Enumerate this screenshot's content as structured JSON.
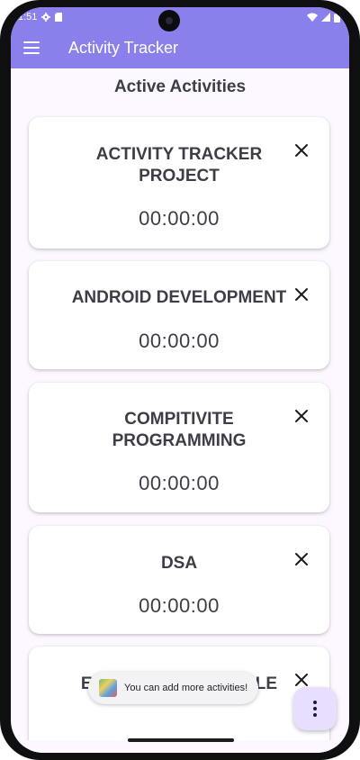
{
  "status_bar": {
    "time": "1:51",
    "icons": [
      "settings-icon",
      "sd-card-icon",
      "wifi-icon",
      "signal-icon",
      "battery-icon"
    ]
  },
  "app_bar": {
    "title": "Activity Tracker",
    "menu_icon": "hamburger-menu-icon"
  },
  "page": {
    "title": "Active Activities"
  },
  "activities": [
    {
      "name": "ACTIVITY TRACKER PROJECT",
      "time": "00:00:00"
    },
    {
      "name": "ANDROID DEVELOPMENT",
      "time": "00:00:00"
    },
    {
      "name": "COMPITIVITE PROGRAMMING",
      "time": "00:00:00"
    },
    {
      "name": "DSA",
      "time": "00:00:00"
    },
    {
      "name": "ENJOY THE STRUGGLE",
      "time": ""
    }
  ],
  "toast": {
    "message": "You can add more activities!"
  },
  "fab": {
    "icon": "more-vert-icon"
  },
  "colors": {
    "primary": "#8a80ec",
    "background": "#fdf7ff",
    "card": "#ffffff",
    "text": "#3d3d47",
    "fab": "#e8defd"
  }
}
